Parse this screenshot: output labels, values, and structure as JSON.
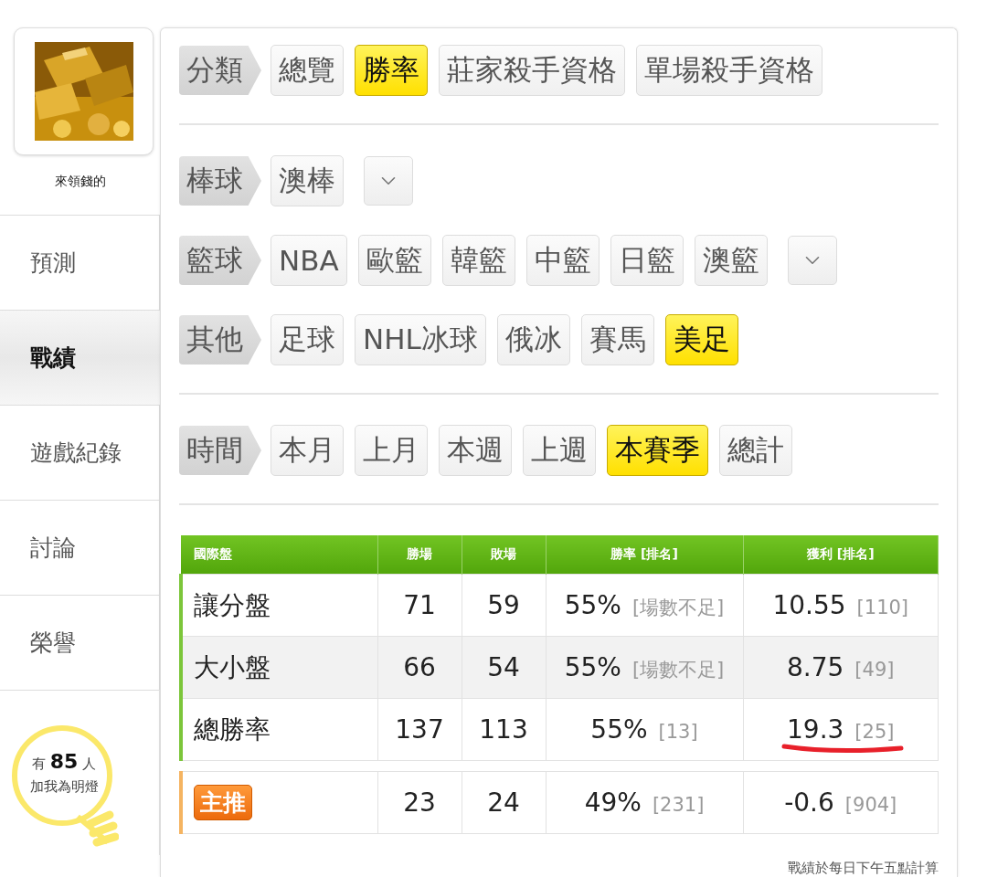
{
  "sidebar": {
    "username": "來領錢的",
    "items": [
      {
        "label": "預測",
        "selected": false
      },
      {
        "label": "戰績",
        "selected": true
      },
      {
        "label": "遊戲紀錄",
        "selected": false
      },
      {
        "label": "討論",
        "selected": false
      },
      {
        "label": "榮譽",
        "selected": false
      }
    ],
    "fans": {
      "prefix": "有",
      "count": "85",
      "suffix": "人",
      "caption": "加我為明燈"
    }
  },
  "filter_groups": [
    {
      "rows": [
        {
          "label": "分類",
          "dropdown": false,
          "options": [
            {
              "label": "總覽",
              "selected": false
            },
            {
              "label": "勝率",
              "selected": true
            },
            {
              "label": "莊家殺手資格",
              "selected": false
            },
            {
              "label": "單場殺手資格",
              "selected": false
            }
          ]
        }
      ]
    },
    {
      "rows": [
        {
          "label": "棒球",
          "dropdown": true,
          "options": [
            {
              "label": "澳棒",
              "selected": false
            }
          ]
        },
        {
          "label": "籃球",
          "dropdown": true,
          "options": [
            {
              "label": "NBA",
              "selected": false
            },
            {
              "label": "歐籃",
              "selected": false
            },
            {
              "label": "韓籃",
              "selected": false
            },
            {
              "label": "中籃",
              "selected": false
            },
            {
              "label": "日籃",
              "selected": false
            },
            {
              "label": "澳籃",
              "selected": false
            }
          ]
        },
        {
          "label": "其他",
          "dropdown": false,
          "options": [
            {
              "label": "足球",
              "selected": false
            },
            {
              "label": "NHL冰球",
              "selected": false
            },
            {
              "label": "俄冰",
              "selected": false
            },
            {
              "label": "賽馬",
              "selected": false
            },
            {
              "label": "美足",
              "selected": true
            }
          ]
        }
      ]
    },
    {
      "rows": [
        {
          "label": "時間",
          "dropdown": false,
          "options": [
            {
              "label": "本月",
              "selected": false
            },
            {
              "label": "上月",
              "selected": false
            },
            {
              "label": "本週",
              "selected": false
            },
            {
              "label": "上週",
              "selected": false
            },
            {
              "label": "本賽季",
              "selected": true
            },
            {
              "label": "總計",
              "selected": false
            }
          ]
        }
      ]
    }
  ],
  "table": {
    "columns": [
      "國際盤",
      "勝場",
      "敗場",
      "勝率 [排名]",
      "獲利 [排名]"
    ],
    "rows": [
      {
        "kind": "stat",
        "label": "讓分盤",
        "wins": "71",
        "losses": "59",
        "rate": "55%",
        "rate_rank": "[場數不足]",
        "profit": "10.55",
        "profit_rank": "[110]"
      },
      {
        "kind": "stat",
        "label": "大小盤",
        "wins": "66",
        "losses": "54",
        "rate": "55%",
        "rate_rank": "[場數不足]",
        "profit": "8.75",
        "profit_rank": "[49]"
      },
      {
        "kind": "stat",
        "label": "總勝率",
        "wins": "137",
        "losses": "113",
        "rate": "55%",
        "rate_rank": "[13]",
        "profit": "19.3",
        "profit_rank": "[25]"
      },
      {
        "kind": "featured",
        "label": "主推",
        "wins": "23",
        "losses": "24",
        "rate": "49%",
        "rate_rank": "[231]",
        "profit": "-0.6",
        "profit_rank": "[904]"
      }
    ]
  },
  "footnote": "戰績於每日下午五點計算"
}
